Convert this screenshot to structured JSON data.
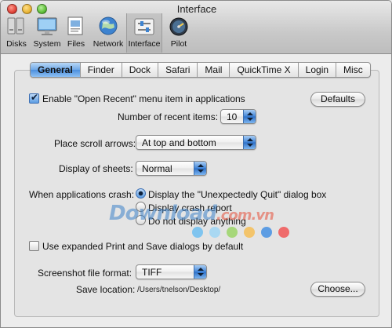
{
  "window": {
    "title": "Interface"
  },
  "toolbar": [
    {
      "label": "Disks",
      "icon": "disks-icon"
    },
    {
      "label": "System",
      "icon": "monitor-icon"
    },
    {
      "label": "Files",
      "icon": "files-icon"
    },
    {
      "label": "Network",
      "icon": "globe-icon"
    },
    {
      "label": "Interface",
      "icon": "sliders-icon",
      "selected": true
    },
    {
      "label": "Pilot",
      "icon": "gauge-icon"
    }
  ],
  "tabs": [
    "General",
    "Finder",
    "Dock",
    "Safari",
    "Mail",
    "QuickTime X",
    "Login",
    "Misc"
  ],
  "active_tab": "General",
  "general": {
    "open_recent_label": "Enable \"Open Recent\" menu item in applications",
    "open_recent_checked": true,
    "defaults_button": "Defaults",
    "recent_items_label": "Number of recent items:",
    "recent_items_value": "10",
    "scroll_arrows_label": "Place scroll arrows:",
    "scroll_arrows_value": "At top and bottom",
    "sheets_label": "Display of sheets:",
    "sheets_value": "Normal",
    "crash_label": "When applications crash:",
    "crash_options": [
      "Display the \"Unexpectedly Quit\" dialog box",
      "Display crash report",
      "Do not display anything"
    ],
    "crash_selected_index": 0,
    "expanded_dialogs_label": "Use expanded Print and Save dialogs by default",
    "expanded_dialogs_checked": false,
    "screenshot_format_label": "Screenshot file format:",
    "screenshot_format_value": "TIFF",
    "save_location_label": "Save location:",
    "save_location_value": "/Users/tnelson/Desktop/",
    "choose_button": "Choose..."
  },
  "watermark": {
    "text": "Download",
    "domain": ".com.vn"
  },
  "colors": {
    "accent": "#4c8fde",
    "watermark_dots": [
      "#7fc4ef",
      "#a9d8f2",
      "#a6d77a",
      "#f3c46b",
      "#5d9de3",
      "#ef6b6b"
    ]
  }
}
